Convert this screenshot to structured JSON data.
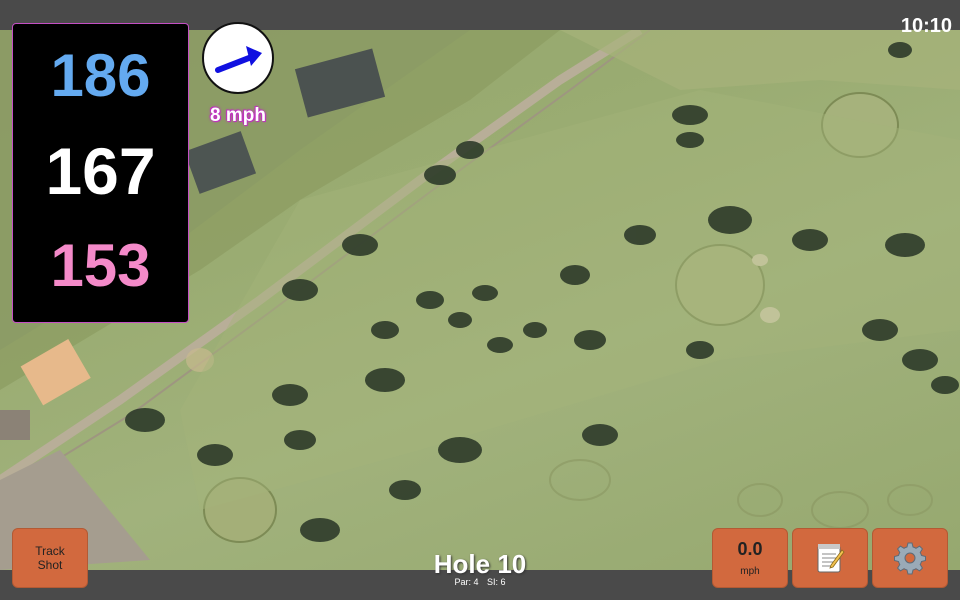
{
  "status": {
    "clock": "10:10"
  },
  "distances": {
    "back": "186",
    "middle": "167",
    "front": "153"
  },
  "wind": {
    "speed_label": "8 mph",
    "direction_icon": "arrow-up-right-icon",
    "arrow_color": "#1010e0"
  },
  "buttons": {
    "track_shot_line1": "Track",
    "track_shot_line2": "Shot",
    "speed_value": "0.0",
    "speed_unit": "mph",
    "notes_icon": "notepad-icon",
    "settings_icon": "gear-icon"
  },
  "hole": {
    "title": "Hole 10",
    "par_label": "Par: 4",
    "si_label": "SI: 6"
  },
  "colors": {
    "back_distance": "#64aaf0",
    "middle_distance": "#ffffff",
    "front_distance": "#f48ac9",
    "button": "#d2693e",
    "panel_border": "#c44fc4"
  }
}
